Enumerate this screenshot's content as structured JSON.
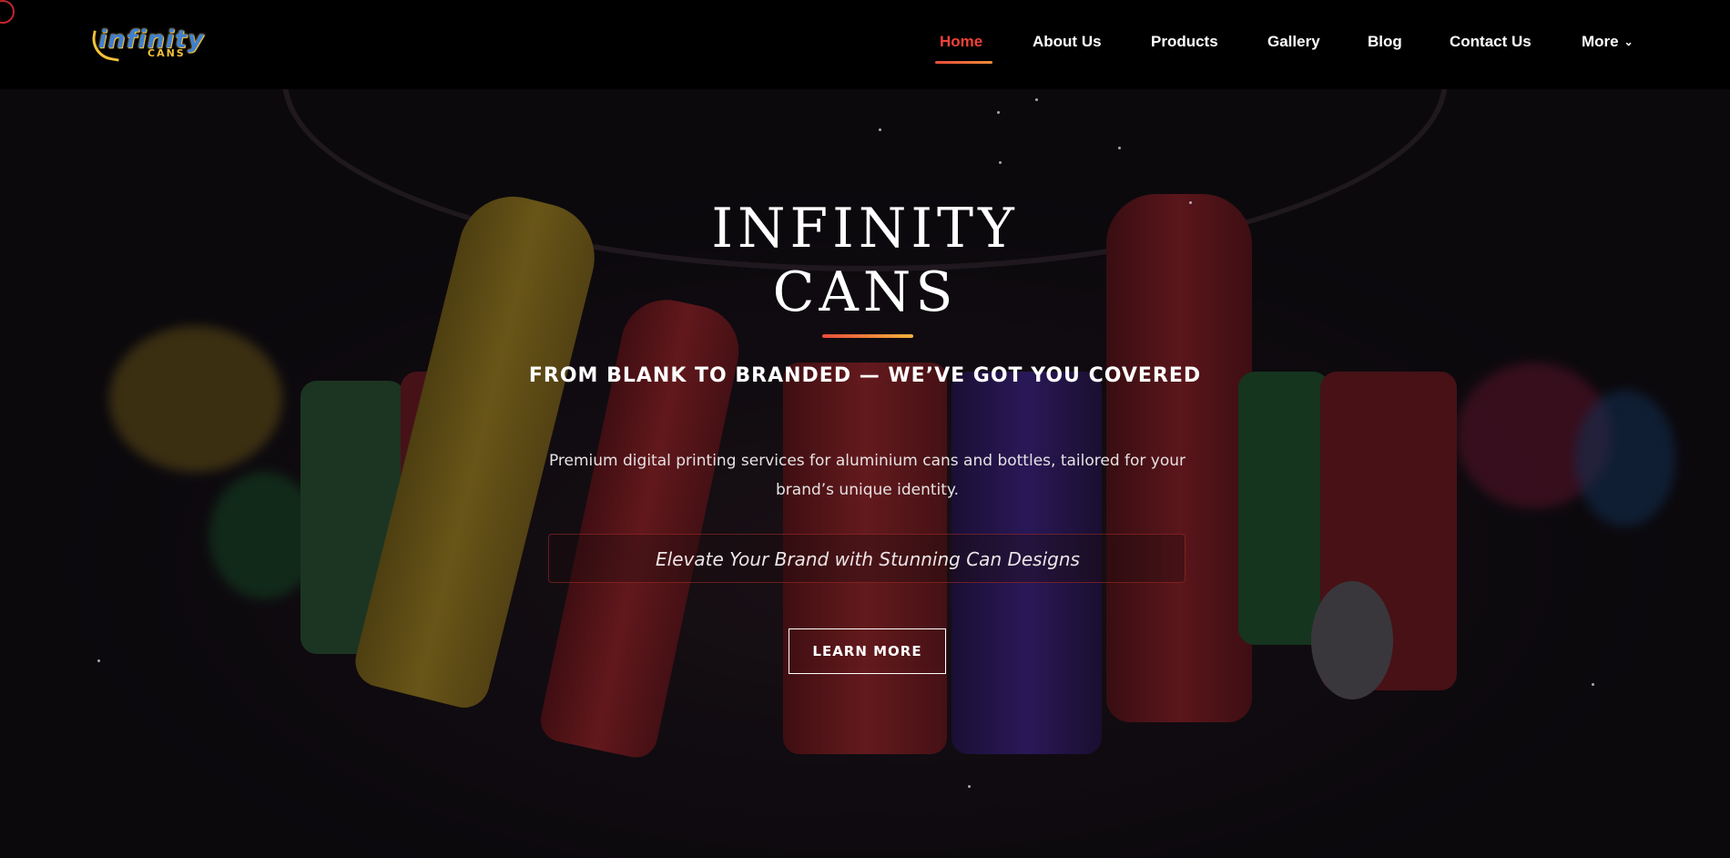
{
  "brand": {
    "logo_word": "infinity",
    "logo_sub": "CANS"
  },
  "nav": {
    "items": [
      {
        "label": "Home",
        "active": true
      },
      {
        "label": "About Us"
      },
      {
        "label": "Products"
      },
      {
        "label": "Gallery"
      },
      {
        "label": "Blog"
      },
      {
        "label": "Contact Us"
      },
      {
        "label": "More",
        "icon": "chevron-down-icon"
      }
    ]
  },
  "hero": {
    "title_line1": "INFINITY",
    "title_line2": "CANS",
    "tagline": "FROM BLANK TO BRANDED — WE’VE GOT YOU COVERED",
    "description": "Premium digital printing services for aluminium cans and bottles, tailored for your brand’s unique identity.",
    "promo": "Elevate Your Brand with Stunning Can Designs",
    "cta_label": "LEARN MORE"
  },
  "colors": {
    "accent": "#ef4136",
    "accent_gradient_end": "#f1b43a",
    "header_bg": "#000000"
  }
}
